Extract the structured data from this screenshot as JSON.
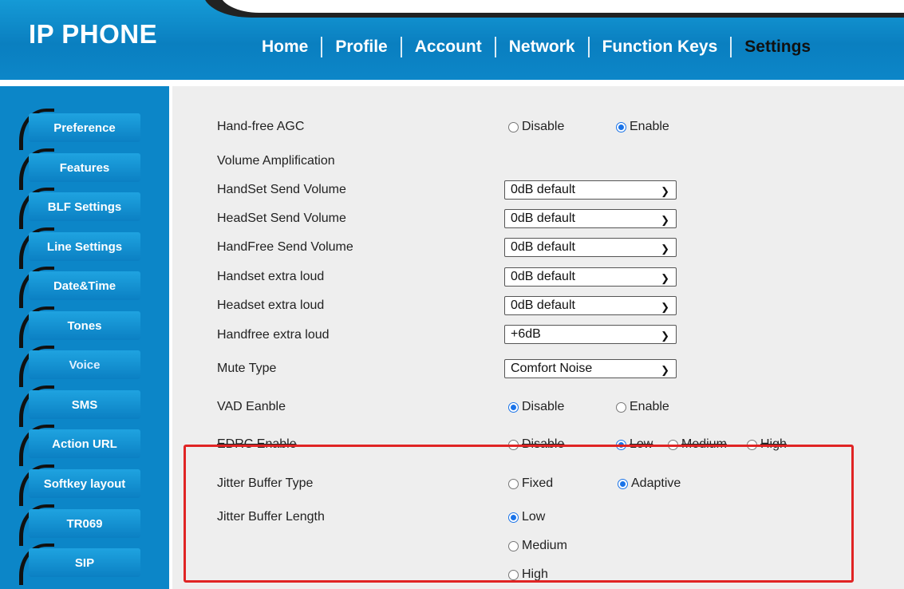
{
  "app_title": "IP PHONE",
  "topnav": [
    "Home",
    "Profile",
    "Account",
    "Network",
    "Function Keys",
    "Settings"
  ],
  "sidebar": [
    "Preference",
    "Features",
    "BLF Settings",
    "Line Settings",
    "Date&Time",
    "Tones",
    "Voice",
    "SMS",
    "Action URL",
    "Softkey layout",
    "TR069",
    "SIP"
  ],
  "settings": {
    "handfree_agc": {
      "label": "Hand-free AGC",
      "opt1": "Disable",
      "opt2": "Enable",
      "selected": "Enable"
    },
    "volume_amp_label": "Volume Amplification",
    "handset_send": {
      "label": "HandSet Send Volume",
      "value": "0dB default"
    },
    "headset_send": {
      "label": "HeadSet Send Volume",
      "value": "0dB default"
    },
    "handfree_send": {
      "label": "HandFree Send Volume",
      "value": "0dB default"
    },
    "handset_loud": {
      "label": "Handset extra loud",
      "value": "0dB default"
    },
    "headset_loud": {
      "label": "Headset extra loud",
      "value": "0dB default"
    },
    "handfree_loud": {
      "label": "Handfree extra loud",
      "value": "+6dB"
    },
    "mute_type": {
      "label": "Mute Type",
      "value": "Comfort Noise"
    },
    "vad": {
      "label": "VAD Eanble",
      "opt1": "Disable",
      "opt2": "Enable",
      "selected": "Disable"
    },
    "edrc": {
      "label": "EDRC Enable",
      "opt1": "Disable",
      "opt2": "Low",
      "opt3": "Medium",
      "opt4": "High",
      "selected": "Low"
    },
    "jitter_type": {
      "label": "Jitter Buffer Type",
      "opt1": "Fixed",
      "opt2": "Adaptive",
      "selected": "Adaptive"
    },
    "jitter_length": {
      "label": "Jitter Buffer Length",
      "opt1": "Low",
      "opt2": "Medium",
      "opt3": "High",
      "selected": "Low"
    }
  },
  "colors": {
    "header_blue": "#0c86c8",
    "highlight_red": "#e02424",
    "radio_blue": "#1a73e8"
  }
}
